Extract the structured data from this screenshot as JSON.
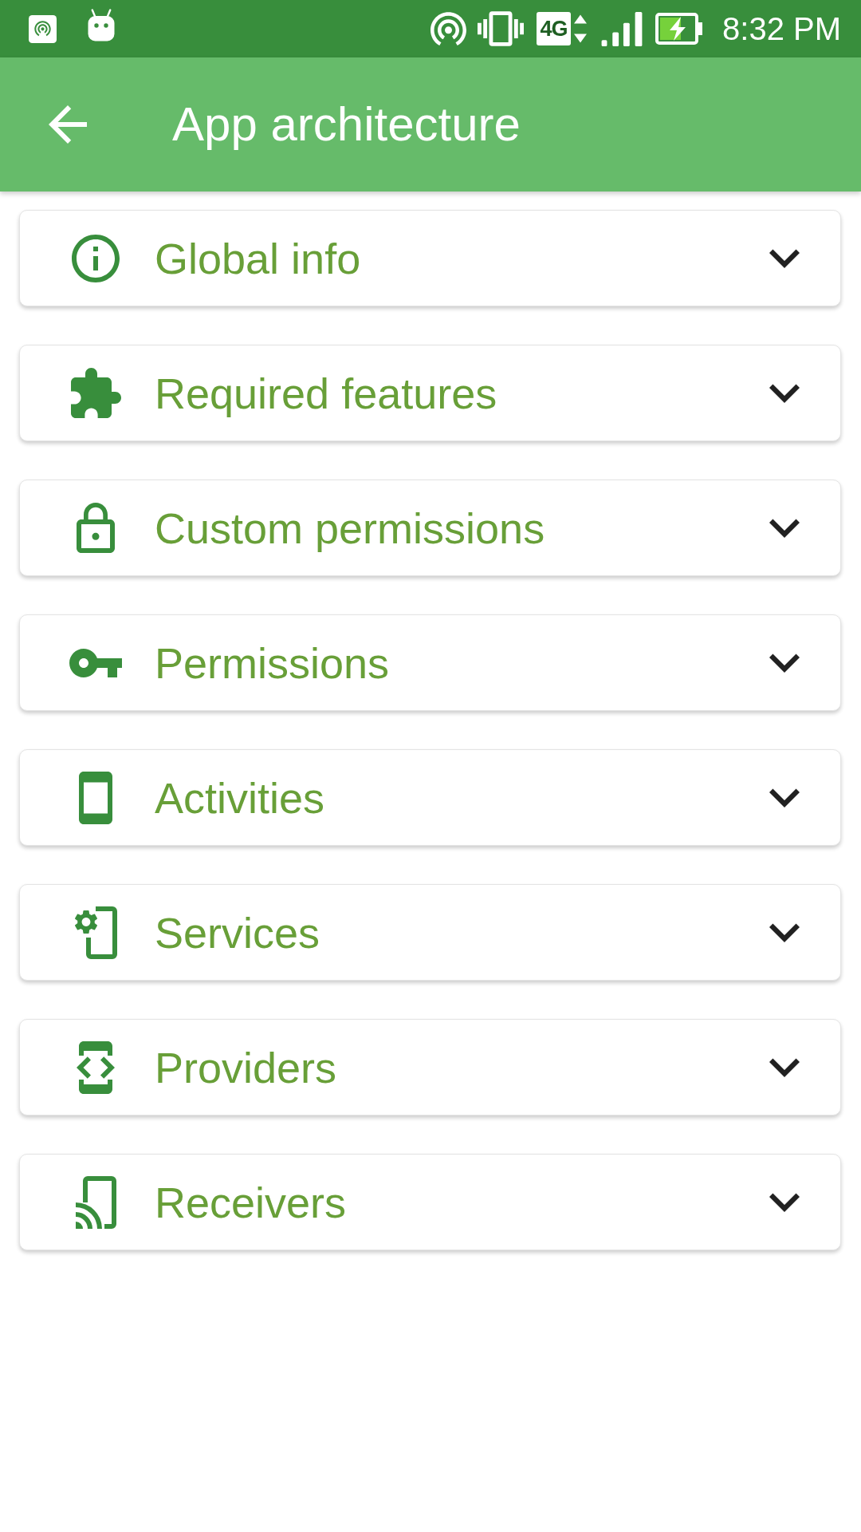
{
  "status_bar": {
    "network_type": "4G",
    "time": "8:32 PM"
  },
  "app_bar": {
    "title": "App architecture"
  },
  "sections": [
    {
      "kind": "info",
      "label": "Global info",
      "expanded": false
    },
    {
      "kind": "puzzle",
      "label": "Required features",
      "expanded": false
    },
    {
      "kind": "lock",
      "label": "Custom permissions",
      "expanded": false
    },
    {
      "kind": "key",
      "label": "Permissions",
      "expanded": false
    },
    {
      "kind": "phone",
      "label": "Activities",
      "expanded": false
    },
    {
      "kind": "phone-gear",
      "label": "Services",
      "expanded": false
    },
    {
      "kind": "phone-code",
      "label": "Providers",
      "expanded": false
    },
    {
      "kind": "phone-cast",
      "label": "Receivers",
      "expanded": false
    }
  ]
}
